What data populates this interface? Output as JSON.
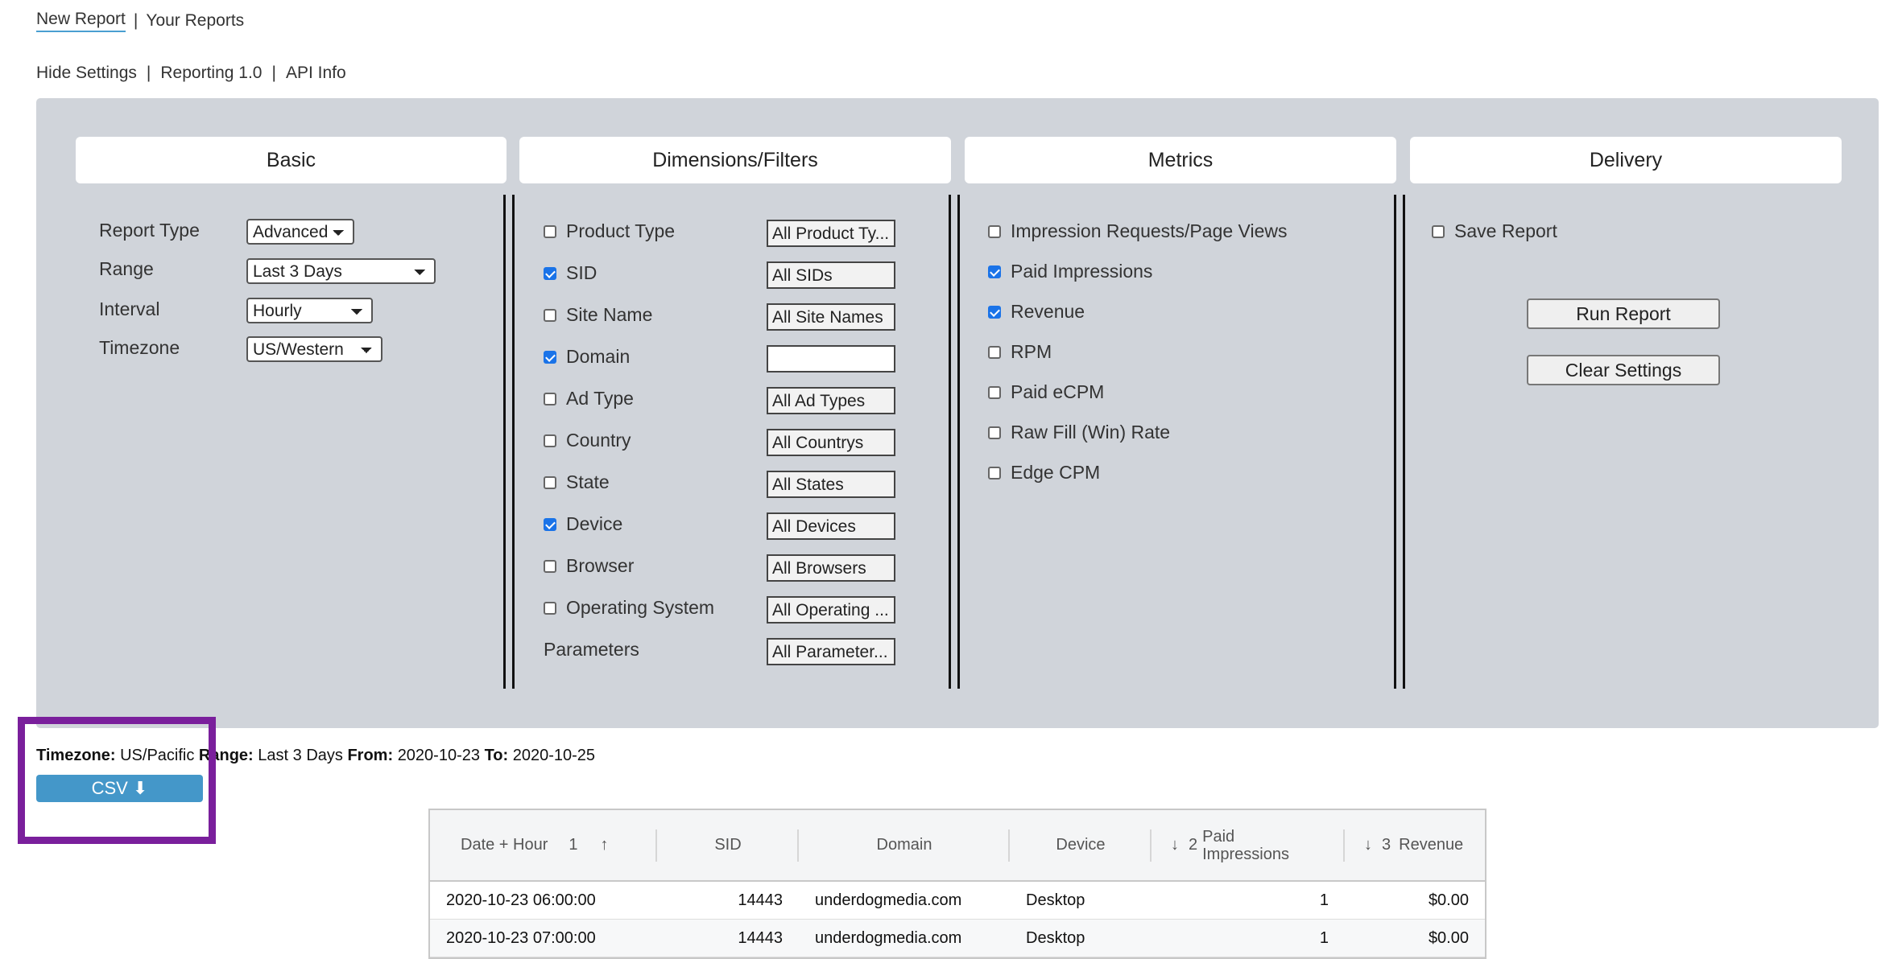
{
  "nav": {
    "new_report": "New Report",
    "your_reports": "Your Reports",
    "separator": "|"
  },
  "subnav": {
    "hide_settings": "Hide Settings",
    "reporting": "Reporting 1.0",
    "api_info": "API Info"
  },
  "columns": {
    "basic": "Basic",
    "dimensions": "Dimensions/Filters",
    "metrics": "Metrics",
    "delivery": "Delivery"
  },
  "basic": {
    "report_type_label": "Report Type",
    "report_type_value": "Advanced",
    "range_label": "Range",
    "range_value": "Last 3 Days",
    "interval_label": "Interval",
    "interval_value": "Hourly",
    "timezone_label": "Timezone",
    "timezone_value": "US/Western"
  },
  "dimensions": [
    {
      "label": "Product Type",
      "checked": false,
      "filter": "All Product Ty..."
    },
    {
      "label": "SID",
      "checked": true,
      "filter": "All SIDs"
    },
    {
      "label": "Site Name",
      "checked": false,
      "filter": "All Site Names"
    },
    {
      "label": "Domain",
      "checked": true,
      "filter": ""
    },
    {
      "label": "Ad Type",
      "checked": false,
      "filter": "All Ad Types"
    },
    {
      "label": "Country",
      "checked": false,
      "filter": "All Countrys"
    },
    {
      "label": "State",
      "checked": false,
      "filter": "All States"
    },
    {
      "label": "Device",
      "checked": true,
      "filter": "All Devices"
    },
    {
      "label": "Browser",
      "checked": false,
      "filter": "All Browsers"
    },
    {
      "label": "Operating System",
      "checked": false,
      "filter": "All Operating ..."
    }
  ],
  "parameters": {
    "label": "Parameters",
    "filter": "All Parameter..."
  },
  "metrics": [
    {
      "label": "Impression Requests/Page Views",
      "checked": false
    },
    {
      "label": "Paid Impressions",
      "checked": true
    },
    {
      "label": "Revenue",
      "checked": true
    },
    {
      "label": "RPM",
      "checked": false
    },
    {
      "label": "Paid eCPM",
      "checked": false
    },
    {
      "label": "Raw Fill (Win) Rate",
      "checked": false
    },
    {
      "label": "Edge CPM",
      "checked": false
    }
  ],
  "delivery": {
    "save_report_label": "Save Report",
    "save_report_checked": false,
    "run_report": "Run Report",
    "clear_settings": "Clear Settings"
  },
  "summary": {
    "timezone_key": "Timezone:",
    "timezone_value": "US/Pacific",
    "range_key": "Range:",
    "range_value": "Last 3 Days",
    "from_key": "From:",
    "from_value": "2020-10-23",
    "to_key": "To:",
    "to_value": "2020-10-25"
  },
  "csv_button": "CSV ⬇",
  "table": {
    "headers": {
      "date_hour": "Date + Hour",
      "date_sort_index": "1",
      "date_sort_arrow": "↑",
      "sid": "SID",
      "domain": "Domain",
      "device": "Device",
      "paid_arrow": "↓",
      "paid_sort_index": "2",
      "paid_impressions": "Paid Impressions",
      "revenue_arrow": "↓",
      "revenue_sort_index": "3",
      "revenue": "Revenue"
    },
    "rows": [
      {
        "date": "2020-10-23 06:00:00",
        "sid": "14443",
        "domain": "underdogmedia.com",
        "device": "Desktop",
        "paid": "1",
        "revenue": "$0.00"
      },
      {
        "date": "2020-10-23 07:00:00",
        "sid": "14443",
        "domain": "underdogmedia.com",
        "device": "Desktop",
        "paid": "1",
        "revenue": "$0.00"
      }
    ]
  }
}
